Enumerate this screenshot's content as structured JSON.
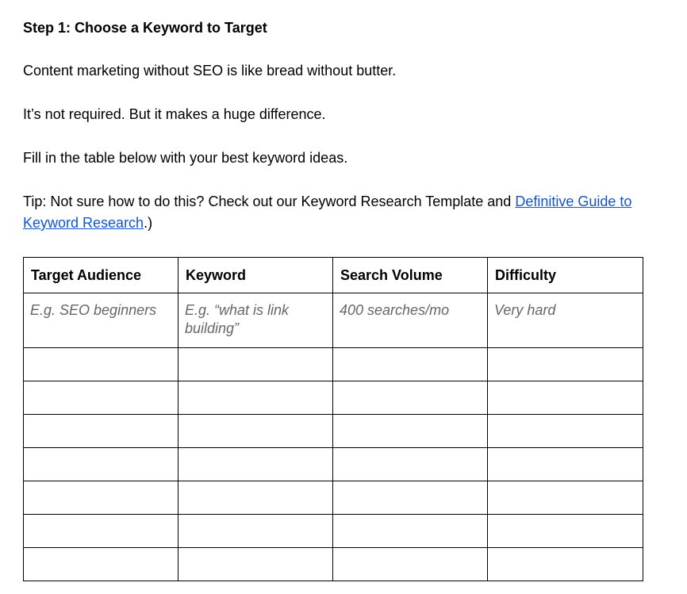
{
  "heading": "Step 1: Choose a Keyword to Target",
  "paragraphs": {
    "p1": "Content marketing without SEO is like bread without butter.",
    "p2": "It’s not required. But it makes a huge difference.",
    "p3": "Fill in the table below with your best keyword ideas.",
    "tip_before": "Tip: Not sure how to do this? Check out our Keyword Research Template and ",
    "tip_link": "Definitive Guide to Keyword Research",
    "tip_after": ".)"
  },
  "colors": {
    "link": "#1155cc",
    "example_text": "#666666",
    "border": "#000000"
  },
  "table": {
    "headers": [
      "Target Audience",
      "Keyword",
      "Search Volume",
      "Difficulty"
    ],
    "example_row": [
      "E.g. SEO beginners",
      "E.g. “what is link building”",
      "400 searches/mo",
      "Very hard"
    ],
    "empty_rows": 7
  }
}
